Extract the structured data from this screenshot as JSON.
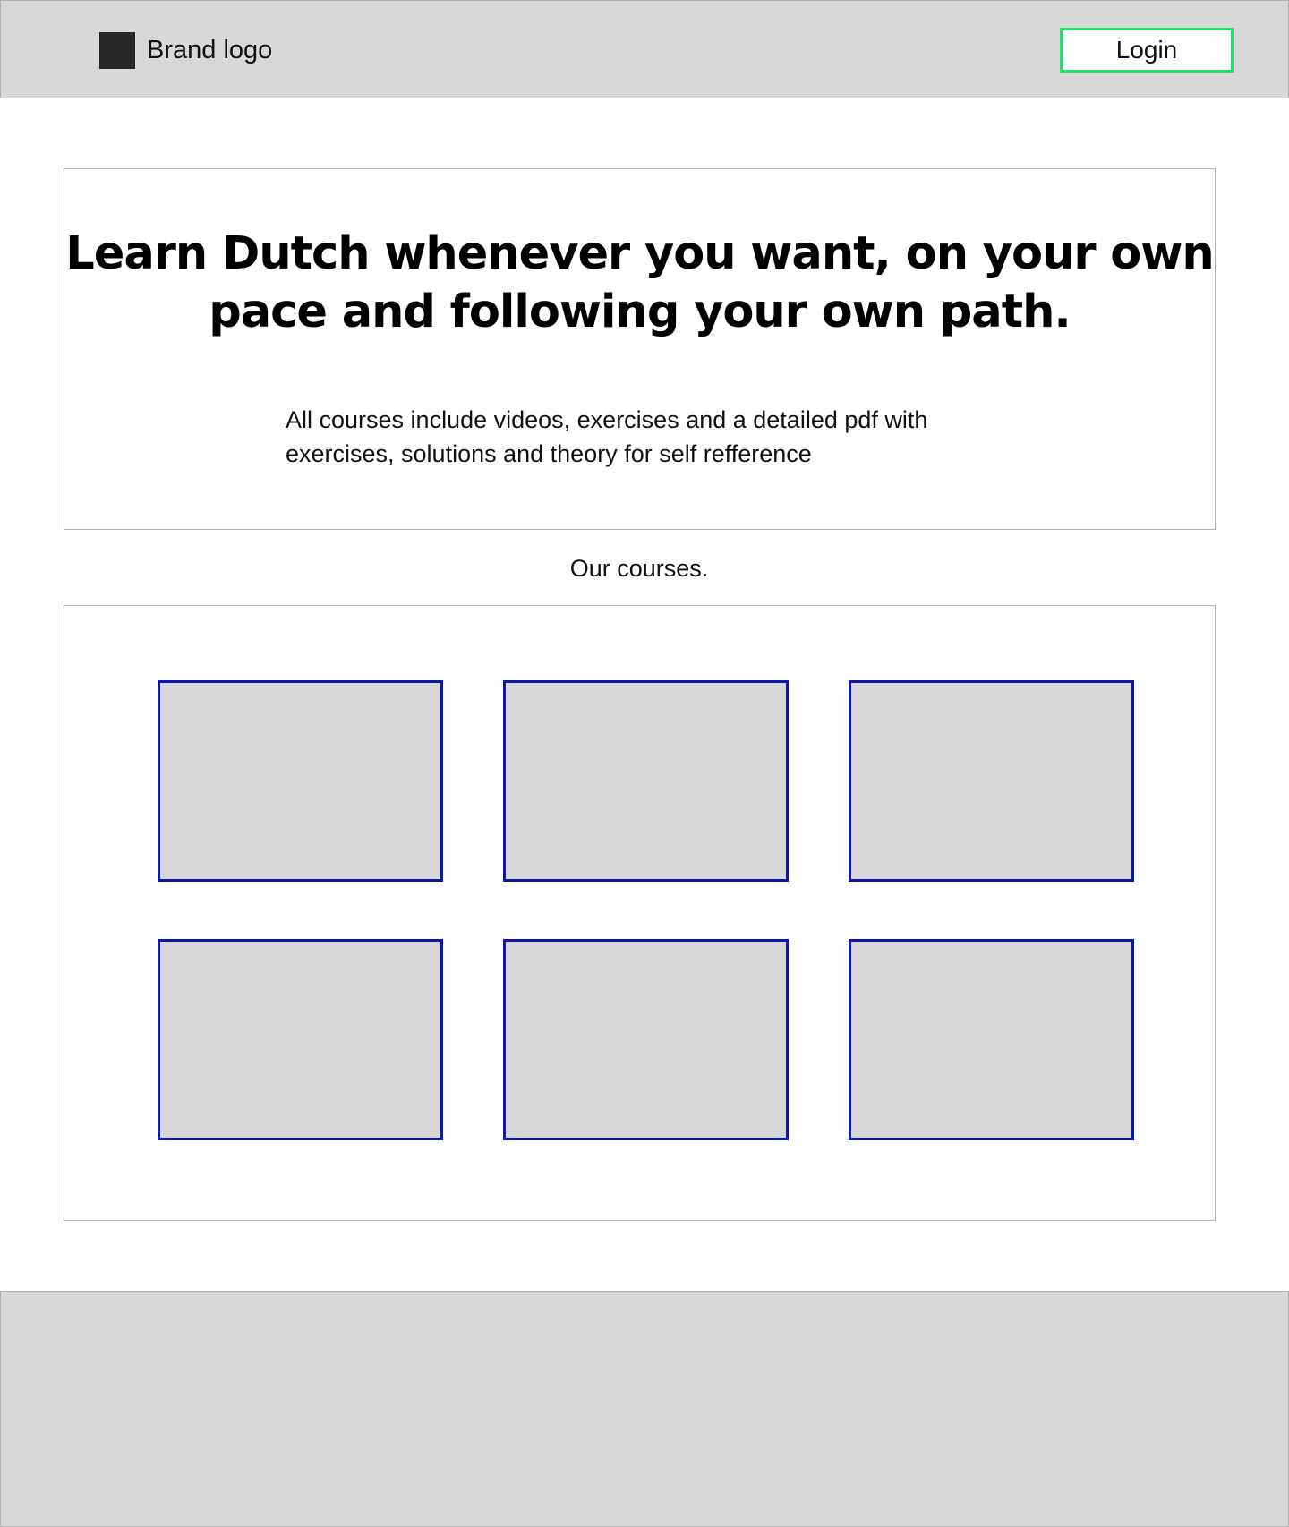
{
  "header": {
    "brand_label": "Brand logo",
    "login_label": "Login"
  },
  "hero": {
    "title": "Learn Dutch whenever you want, on your own pace and following your own path.",
    "description": "All courses include videos, exercises and a detailed pdf with exercises, solutions and theory for self refference"
  },
  "courses": {
    "heading": "Our courses.",
    "cards": 6
  },
  "colors": {
    "header_bg": "#d8d8d8",
    "login_border": "#22e36a",
    "card_border": "#0e17a8",
    "card_fill": "#d8d8d8",
    "footer_bg": "#d8d8d8"
  }
}
